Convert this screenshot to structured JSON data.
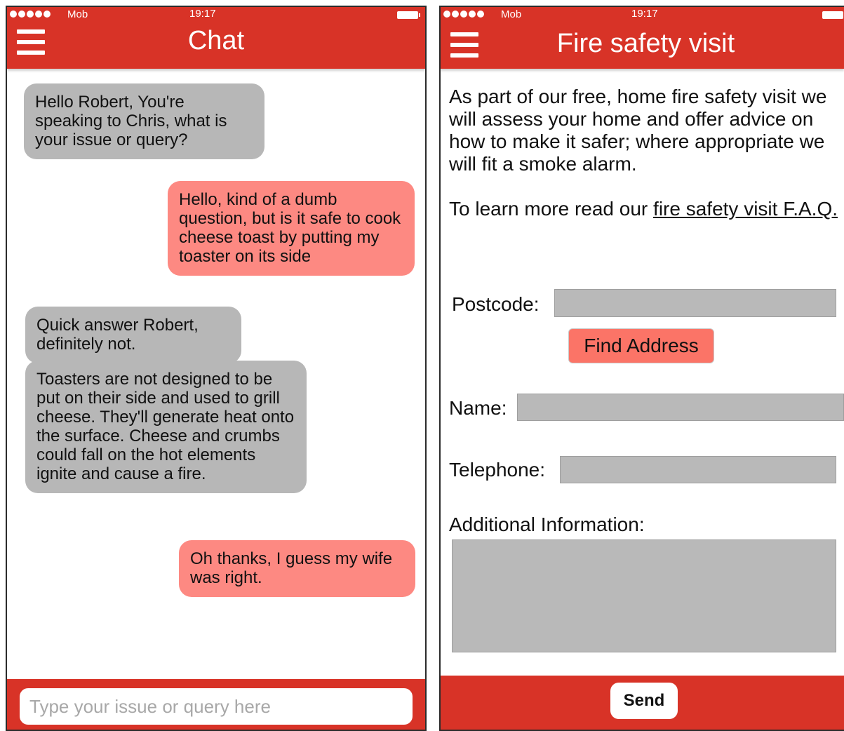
{
  "status_bar": {
    "carrier": "Mob",
    "time": "19:17"
  },
  "chat_screen": {
    "title": "Chat",
    "messages": [
      {
        "sender": "agent",
        "text": "Hello Robert, You're speaking to Chris, what is your issue or query?"
      },
      {
        "sender": "user",
        "text": "Hello, kind of a dumb question, but is it safe to cook cheese toast by putting my toaster on its side"
      },
      {
        "sender": "agent",
        "text": "Quick answer Robert, definitely not."
      },
      {
        "sender": "agent",
        "text": "Toasters are not designed to be put on their side and used to grill cheese. They'll generate heat onto the surface. Cheese and crumbs could fall on the hot elements ignite and cause a fire."
      },
      {
        "sender": "user",
        "text": "Oh thanks, I guess my wife was right."
      }
    ],
    "input_placeholder": "Type your issue or query here"
  },
  "fire_screen": {
    "title": "Fire safety visit",
    "intro": "As part of our free, home fire safety visit we will assess your home and offer advice on how to make it safer; where appropriate we will fit a smoke alarm.",
    "learn_prefix": "To learn more read our ",
    "learn_link": "fire safety visit F.A.Q.",
    "postcode_label": "Postcode:",
    "find_address_label": "Find Address",
    "name_label": "Name:",
    "telephone_label": "Telephone:",
    "additional_label": "Additional Information:",
    "send_label": "Send"
  },
  "colors": {
    "header_red": "#d83327",
    "agent_bubble": "#b7b7b7",
    "user_bubble": "#fd8982",
    "button_salmon": "#fb7467",
    "field_gray": "#b9b9b9"
  }
}
